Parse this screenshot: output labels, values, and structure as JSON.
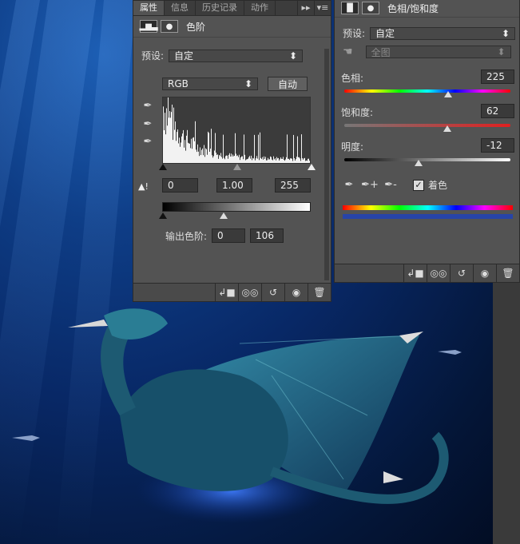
{
  "levels_panel": {
    "tabs": [
      "属性",
      "信息",
      "历史记录",
      "动作"
    ],
    "active_tab": "属性",
    "title": "色阶",
    "preset_label": "预设:",
    "preset_value": "自定",
    "channel_value": "RGB",
    "auto_label": "自动",
    "input_black": "0",
    "input_gamma": "1.00",
    "input_white": "255",
    "output_label": "输出色阶:",
    "output_black": "0",
    "output_white": "106"
  },
  "hue_panel": {
    "title": "色相/饱和度",
    "preset_label": "预设:",
    "preset_value": "自定",
    "range_value": "全图",
    "hue_label": "色相:",
    "hue_value": "225",
    "sat_label": "饱和度:",
    "sat_value": "62",
    "light_label": "明度:",
    "light_value": "-12",
    "colorize_label": "着色",
    "colorize_checked": true
  },
  "icons": [
    "levels-icon",
    "mask-icon",
    "eyedropper-icon",
    "warning-icon",
    "clip-icon",
    "visibility-icon",
    "reset-icon",
    "eye-icon",
    "trash-icon",
    "hand-icon"
  ]
}
